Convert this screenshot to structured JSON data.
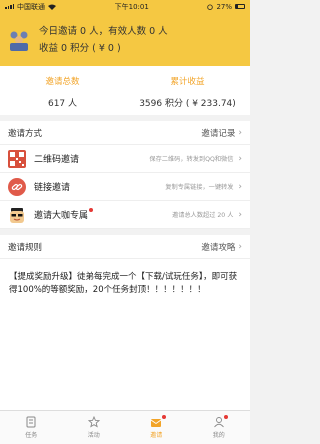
{
  "statusbar": {
    "carrier": "中国联通",
    "time": "下午10:01",
    "battery": "27%"
  },
  "header": {
    "line1": "今日邀请 0 人，有效人数 0 人",
    "line2": "收益 0 积分 ( ¥ 0 )",
    "avatar_icon": "group-users-icon"
  },
  "stats": {
    "total_invites_label": "邀请总数",
    "total_invites_value": "617 人",
    "total_earnings_label": "累计收益",
    "total_earnings_value": "3596 积分 ( ¥ 233.74)"
  },
  "invite_methods": {
    "heading": "邀请方式",
    "more": "邀请记录",
    "items": [
      {
        "title": "二维码邀请",
        "desc": "保存二维码，转发到QQ和微信",
        "icon": "qr-code-icon"
      },
      {
        "title": "链接邀请",
        "desc": "复制专属链接，一键转发",
        "icon": "link-icon"
      },
      {
        "title": "邀请大咖专属",
        "desc": "邀请总人数超过 20 人",
        "icon": "vip-face-icon"
      }
    ]
  },
  "rules": {
    "heading": "邀请规则",
    "more": "邀请攻略",
    "text": "【提成奖励升级】徒弟每完成一个【下载/试玩任务】，即可获得100%的等额奖励，20个任务封顶！！！！！！！"
  },
  "tabbar": {
    "items": [
      {
        "label": "任务",
        "icon": "task-icon"
      },
      {
        "label": "活动",
        "icon": "star-icon"
      },
      {
        "label": "邀请",
        "icon": "invite-icon"
      },
      {
        "label": "我的",
        "icon": "profile-icon"
      }
    ],
    "active_index": 2
  },
  "colors": {
    "brand": "#f5c842",
    "accent": "#f2a428",
    "badge": "#e53935"
  }
}
